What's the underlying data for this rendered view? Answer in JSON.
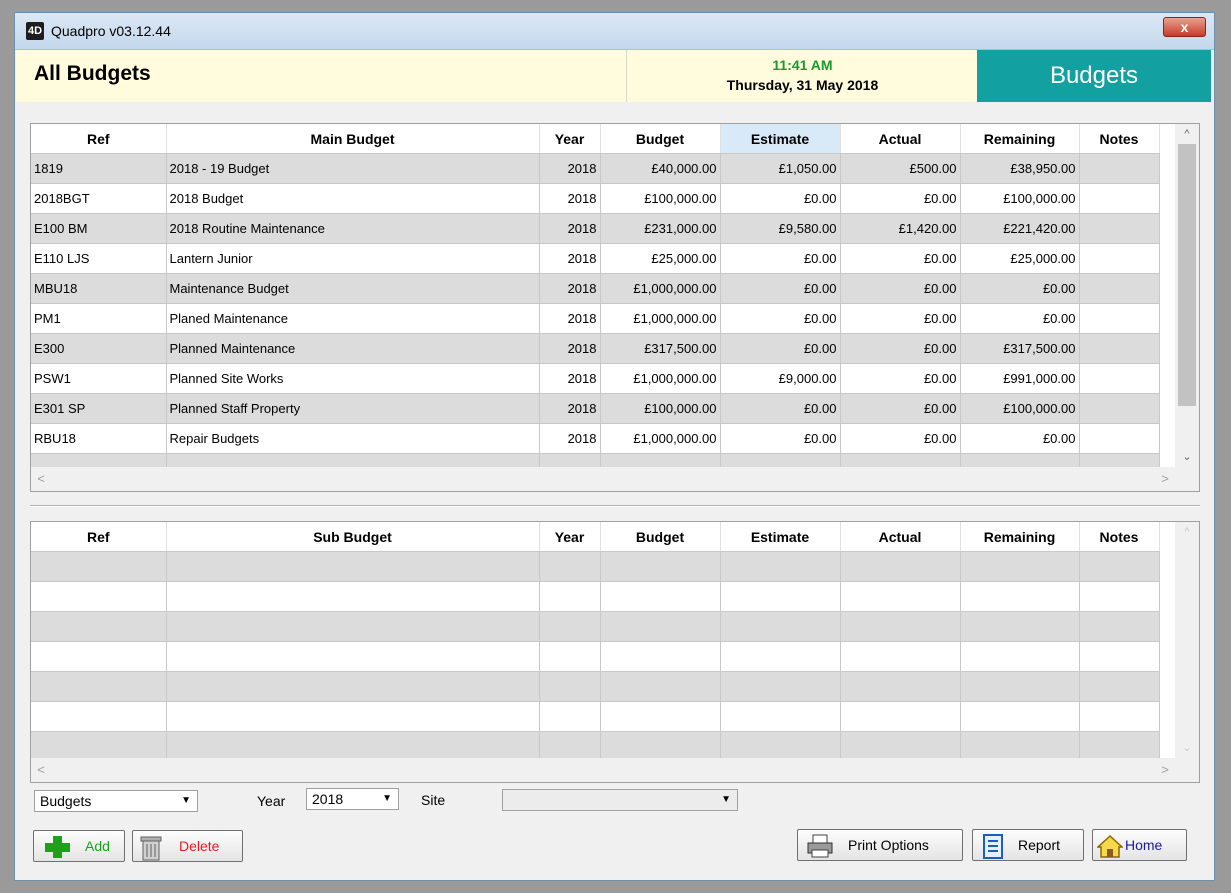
{
  "window": {
    "title": "Quadpro v03.12.44",
    "close_label": "x"
  },
  "header": {
    "title": "All Budgets",
    "time": "11:41 AM",
    "date": "Thursday, 31 May 2018",
    "module": "Budgets"
  },
  "colors": {
    "clock": "#1a9a2c",
    "module_bg": "#12a0a0",
    "add": "#1aa31a",
    "delete": "#e02020",
    "home": "#1a1a9a"
  },
  "main_grid": {
    "columns": [
      "Ref",
      "Main Budget",
      "Year",
      "Budget",
      "Estimate",
      "Actual",
      "Remaining",
      "Notes"
    ],
    "highlighted_column": "Estimate",
    "rows": [
      {
        "ref": "1819",
        "name": "2018 - 19 Budget",
        "year": "2018",
        "budget": "£40,000.00",
        "estimate": "£1,050.00",
        "actual": "£500.00",
        "remaining": "£38,950.00",
        "notes": ""
      },
      {
        "ref": "2018BGT",
        "name": "2018 Budget",
        "year": "2018",
        "budget": "£100,000.00",
        "estimate": "£0.00",
        "actual": "£0.00",
        "remaining": "£100,000.00",
        "notes": ""
      },
      {
        "ref": "E100 BM",
        "name": "2018 Routine Maintenance",
        "year": "2018",
        "budget": "£231,000.00",
        "estimate": "£9,580.00",
        "actual": "£1,420.00",
        "remaining": "£221,420.00",
        "notes": ""
      },
      {
        "ref": "E110 LJS",
        "name": "Lantern Junior",
        "year": "2018",
        "budget": "£25,000.00",
        "estimate": "£0.00",
        "actual": "£0.00",
        "remaining": "£25,000.00",
        "notes": ""
      },
      {
        "ref": "MBU18",
        "name": "Maintenance Budget",
        "year": "2018",
        "budget": "£1,000,000.00",
        "estimate": "£0.00",
        "actual": "£0.00",
        "remaining": "£0.00",
        "notes": ""
      },
      {
        "ref": "PM1",
        "name": "Planed Maintenance",
        "year": "2018",
        "budget": "£1,000,000.00",
        "estimate": "£0.00",
        "actual": "£0.00",
        "remaining": "£0.00",
        "notes": ""
      },
      {
        "ref": "E300",
        "name": "Planned Maintenance",
        "year": "2018",
        "budget": "£317,500.00",
        "estimate": "£0.00",
        "actual": "£0.00",
        "remaining": "£317,500.00",
        "notes": ""
      },
      {
        "ref": "PSW1",
        "name": "Planned Site Works",
        "year": "2018",
        "budget": "£1,000,000.00",
        "estimate": "£9,000.00",
        "actual": "£0.00",
        "remaining": "£991,000.00",
        "notes": ""
      },
      {
        "ref": "E301 SP",
        "name": "Planned Staff Property",
        "year": "2018",
        "budget": "£100,000.00",
        "estimate": "£0.00",
        "actual": "£0.00",
        "remaining": "£100,000.00",
        "notes": ""
      },
      {
        "ref": "RBU18",
        "name": "Repair Budgets",
        "year": "2018",
        "budget": "£1,000,000.00",
        "estimate": "£0.00",
        "actual": "£0.00",
        "remaining": "£0.00",
        "notes": ""
      }
    ]
  },
  "sub_grid": {
    "columns": [
      "Ref",
      "Sub Budget",
      "Year",
      "Budget",
      "Estimate",
      "Actual",
      "Remaining",
      "Notes"
    ]
  },
  "filters": {
    "type_value": "Budgets",
    "year_label": "Year",
    "year_value": "2018",
    "site_label": "Site",
    "site_value": ""
  },
  "buttons": {
    "add": "Add",
    "delete": "Delete",
    "print_options": "Print Options",
    "report": "Report",
    "home": "Home"
  },
  "icons": {
    "app": "app-icon",
    "add": "plus-icon",
    "delete": "trash-icon",
    "print": "printer-icon",
    "report": "document-icon",
    "home": "house-icon"
  }
}
